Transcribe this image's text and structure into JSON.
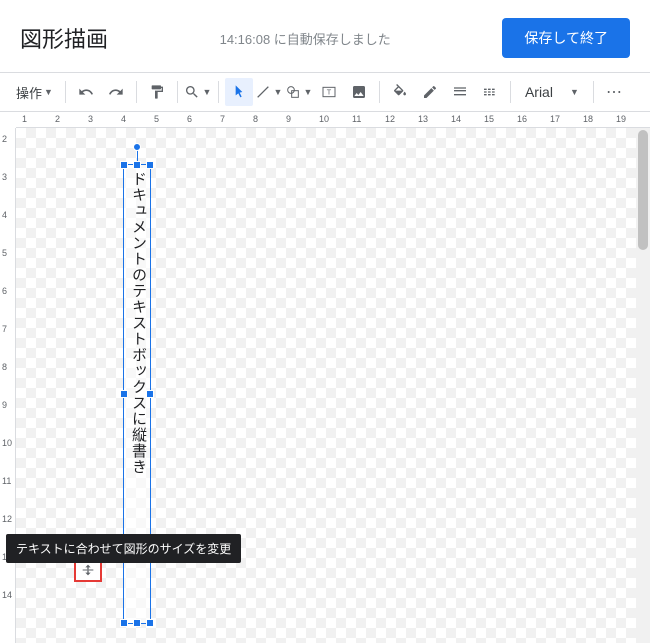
{
  "header": {
    "title": "図形描画",
    "autosave": "14:16:08 に自動保存しました",
    "save_btn": "保存して終了"
  },
  "toolbar": {
    "actions": "操作",
    "font": "Arial"
  },
  "ruler_h": [
    "1",
    "2",
    "3",
    "4",
    "5",
    "6",
    "7",
    "8",
    "9",
    "10",
    "11",
    "12",
    "13",
    "14",
    "15",
    "16",
    "17",
    "18",
    "19"
  ],
  "ruler_v": [
    "2",
    "3",
    "4",
    "5",
    "6",
    "7",
    "8",
    "9",
    "10",
    "11",
    "12",
    "13",
    "14"
  ],
  "textbox": {
    "content": "ドキュメントのテキストボックスに縦書き"
  },
  "tooltip": "テキストに合わせて図形のサイズを変更"
}
